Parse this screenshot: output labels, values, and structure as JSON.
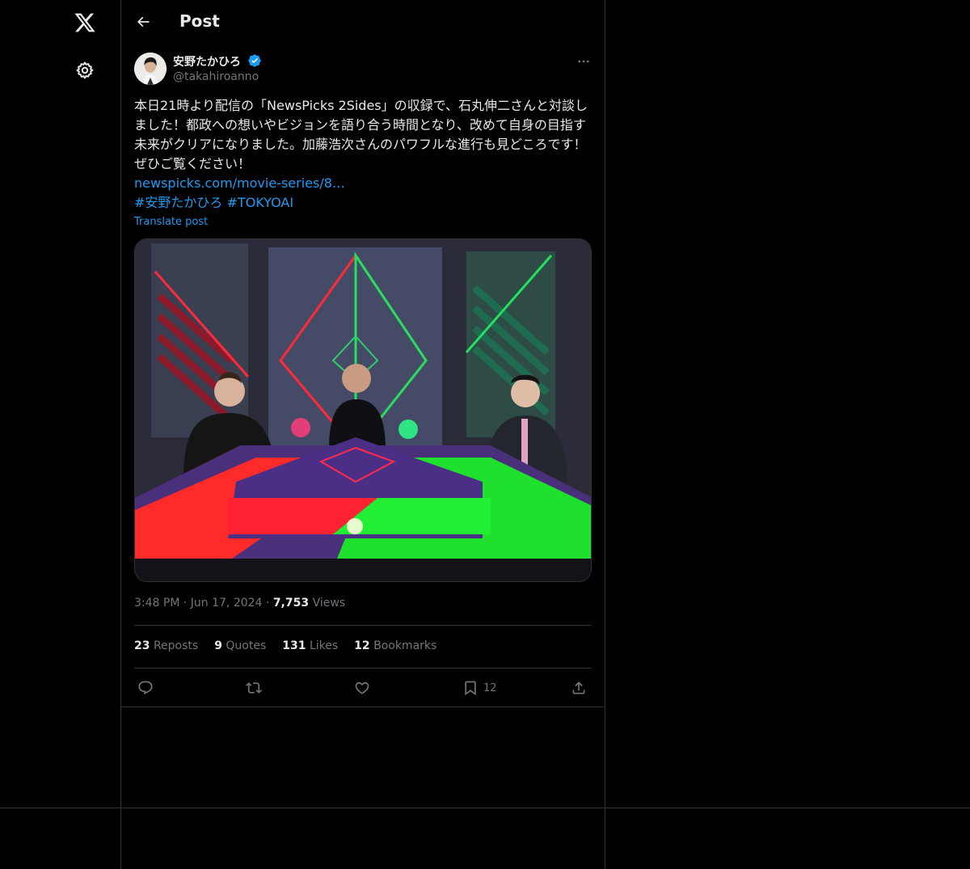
{
  "header": {
    "title": "Post"
  },
  "post": {
    "author_name": "安野たかひろ",
    "handle": "@takahiroanno",
    "text": "本日21時より配信の「NewsPicks 2Sides」の収録で、石丸伸二さんと対談しました！都政への想いやビジョンを語り合う時間となり、改めて自身の目指す未来がクリアになりました。加藤浩次さんのパワフルな進行も見どころです！ぜひご覧ください！",
    "link": "newspicks.com/movie-series/8…",
    "hashtags": [
      "#安野たかひろ",
      "#TOKYOAI"
    ],
    "translate": "Translate post",
    "time": "3:48 PM",
    "date": "Jun 17, 2024",
    "views_count": "7,753",
    "views_label": "Views"
  },
  "stats": {
    "reposts_count": "23",
    "reposts_label": "Reposts",
    "quotes_count": "9",
    "quotes_label": "Quotes",
    "likes_count": "131",
    "likes_label": "Likes",
    "bookmarks_count": "12",
    "bookmarks_label": "Bookmarks"
  },
  "actions": {
    "bookmark_count": "12"
  },
  "icons": {
    "logo": "x-logo-icon",
    "settings": "gear-icon",
    "back": "arrow-left-icon",
    "verified": "verified-badge-icon",
    "more": "more-horizontal-icon",
    "reply": "reply-icon",
    "repost": "repost-icon",
    "like": "heart-icon",
    "bookmark": "bookmark-icon",
    "share": "share-icon"
  },
  "colors": {
    "background": "#000000",
    "text": "#e7e9ea",
    "muted": "#71767b",
    "accent": "#1d9bf0",
    "border": "#2f3336"
  }
}
